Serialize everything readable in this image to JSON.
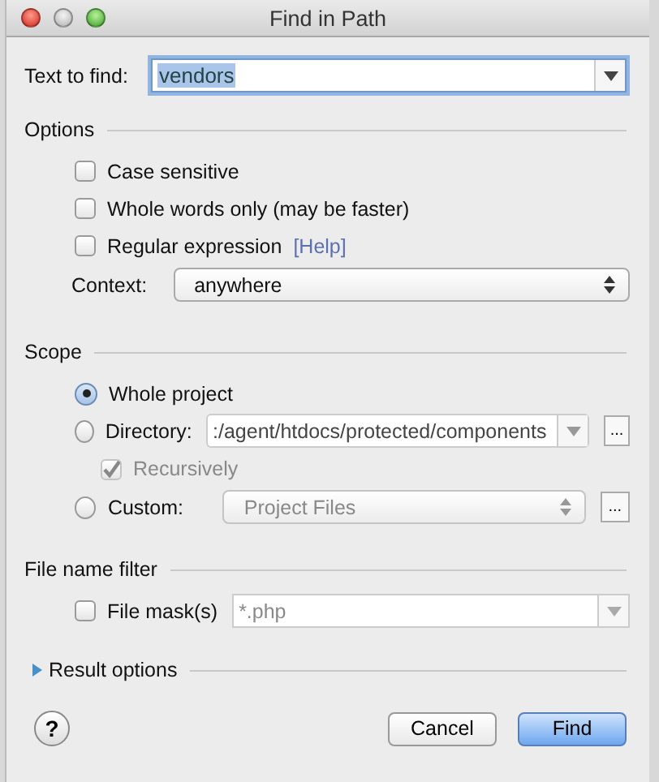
{
  "window": {
    "title": "Find in Path"
  },
  "text_to_find": {
    "label": "Text to find:",
    "value": "vendors",
    "value_selected": true
  },
  "options": {
    "title": "Options",
    "checkboxes": [
      {
        "label": "Case sensitive",
        "checked": false
      },
      {
        "label": "Whole words only (may be faster)",
        "checked": false
      },
      {
        "label": "Regular expression",
        "checked": false,
        "help_link": "[Help]"
      }
    ],
    "context": {
      "label": "Context:",
      "value": "anywhere"
    }
  },
  "scope": {
    "title": "Scope",
    "whole_project": {
      "label": "Whole project",
      "selected": true
    },
    "directory": {
      "label": "Directory:",
      "selected": false,
      "value": ":/agent/htdocs/protected/components",
      "browse": "...",
      "recursively": {
        "label": "Recursively",
        "checked": true,
        "disabled": true
      }
    },
    "custom": {
      "label": "Custom:",
      "selected": false,
      "value": "Project Files",
      "disabled": true,
      "browse": "..."
    }
  },
  "file_name_filter": {
    "title": "File name filter",
    "file_mask": {
      "label": "File mask(s)",
      "checked": false,
      "value": "*.php",
      "disabled": true
    }
  },
  "result_options": {
    "title": "Result options",
    "expanded": false
  },
  "help_button": "?",
  "buttons": [
    {
      "label": "Cancel",
      "default": false
    },
    {
      "label": "Find",
      "default": true
    }
  ]
}
